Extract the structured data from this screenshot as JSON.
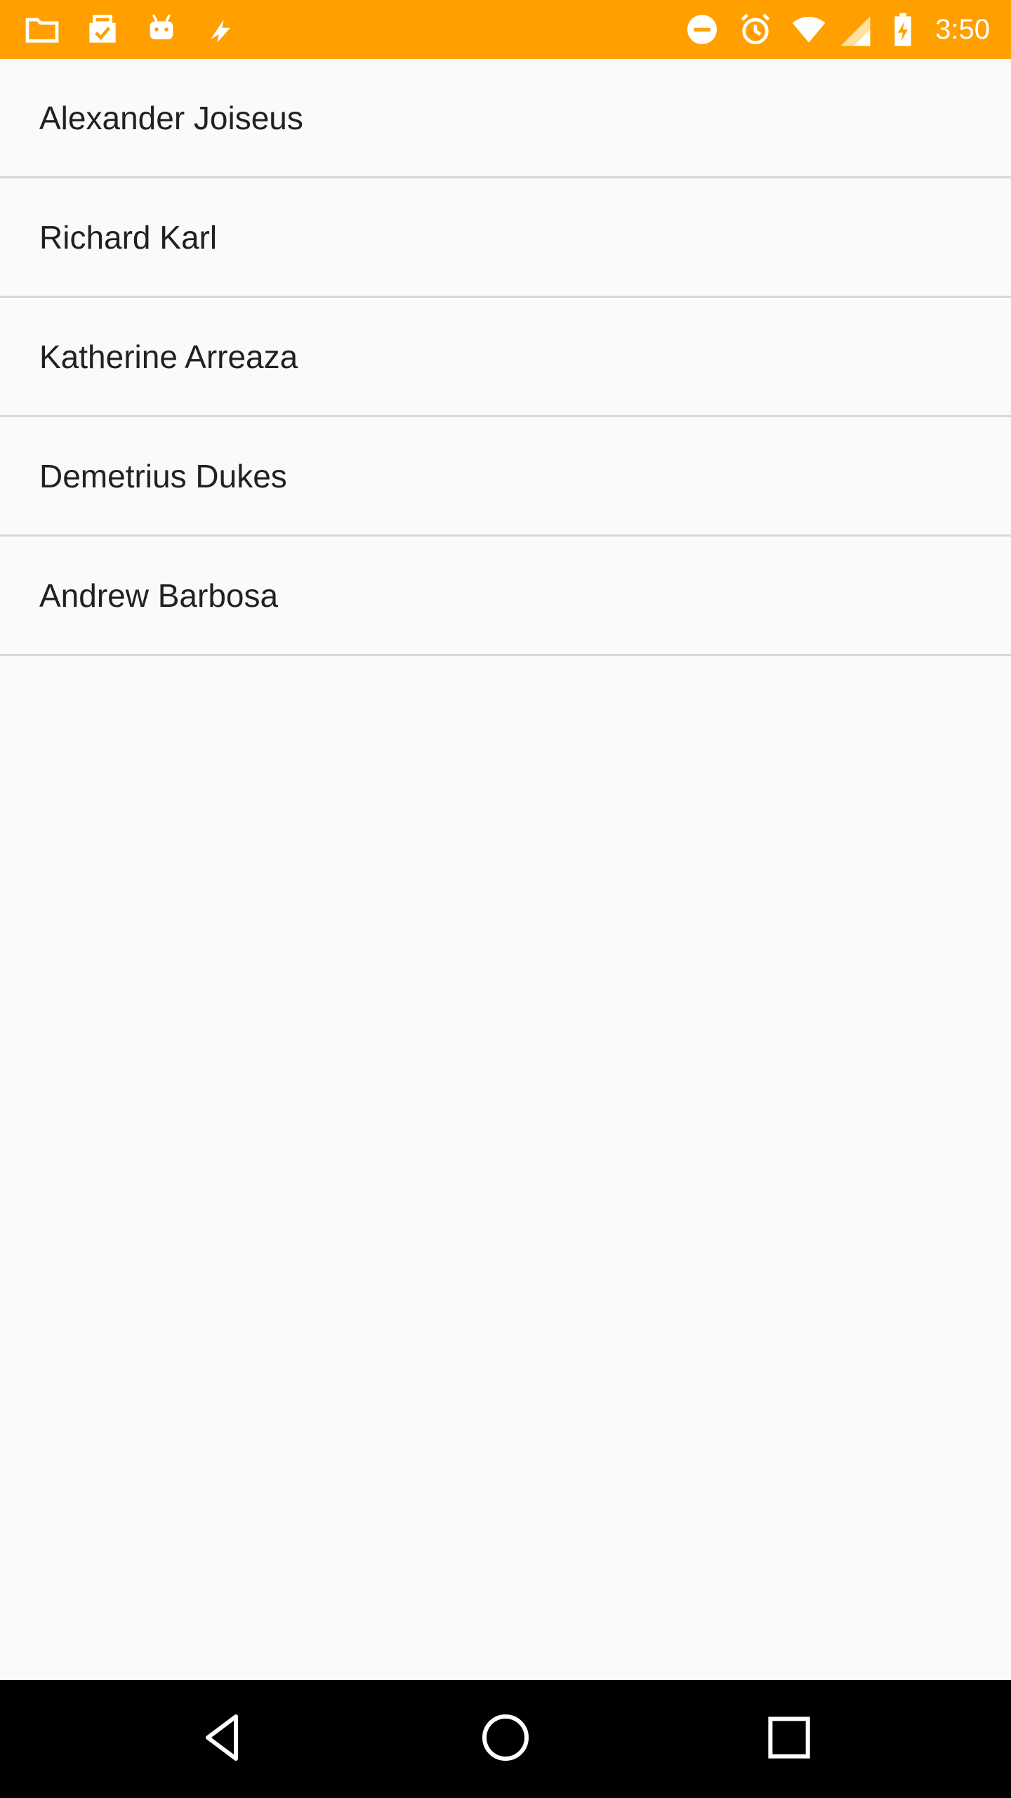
{
  "status_bar": {
    "background_color": "#ffa000",
    "time": "3:50",
    "left_icons": [
      "folder-icon",
      "clipboard-check-icon",
      "android-icon",
      "lightning-icon"
    ],
    "right_icons": [
      "do-not-disturb-icon",
      "alarm-icon",
      "wifi-icon",
      "signal-icon",
      "battery-charging-icon"
    ]
  },
  "contacts": [
    {
      "name": "Alexander Joiseus"
    },
    {
      "name": "Richard Karl"
    },
    {
      "name": "Katherine Arreaza"
    },
    {
      "name": "Demetrius Dukes"
    },
    {
      "name": "Andrew Barbosa"
    }
  ],
  "nav_bar": {
    "buttons": [
      "back-icon",
      "home-icon",
      "recents-icon"
    ]
  }
}
